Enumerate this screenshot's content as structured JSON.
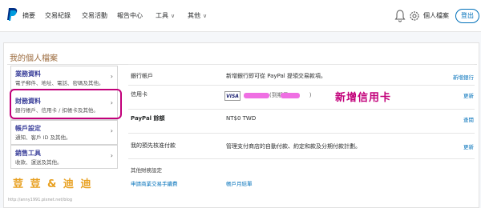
{
  "nav": {
    "items": [
      "摘要",
      "交易紀錄",
      "交易活動",
      "報告中心",
      "工具",
      "其他"
    ],
    "account_label": "個人檔案",
    "logout_label": "登出"
  },
  "page": {
    "title": "我的個人檔案"
  },
  "sidebar": {
    "items": [
      {
        "title": "業務資料",
        "desc": "電子郵件、地址、電話、密碼及其他。"
      },
      {
        "title": "財務資料",
        "desc": "銀行帳戶、信用卡 / 扣帳卡及其他。"
      },
      {
        "title": "帳戶設定",
        "desc": "通知、客戶 ID 及其他。"
      },
      {
        "title": "銷售工具",
        "desc": "收款、運送及其他。"
      }
    ]
  },
  "rows": {
    "bank": {
      "label": "銀行帳戶",
      "value": "新增銀行即可從 PayPal 提領交易款項。",
      "link": "新增銀行"
    },
    "card": {
      "label": "信用卡",
      "brand": "VISA",
      "expiry_prefix": "(到期日",
      "expiry_suffix": ")",
      "link": "更新"
    },
    "balance": {
      "label": "PayPal 餘額",
      "value": "NT$0 TWD",
      "link": "查閱"
    },
    "preapproved": {
      "label": "我的預先核准付款",
      "value": "管理支付商店的自動付款、約定和款及分期付款計劃。",
      "link": "更新"
    },
    "other": {
      "label": "其他財務設定",
      "links": [
        "申請商業交易手續費",
        "帳戶月結單"
      ]
    }
  },
  "annotation": "新增信用卡",
  "watermark": {
    "text": "荳 荳 & 迪 迪",
    "url": "http://anny1991.pixnet.net/blog"
  }
}
